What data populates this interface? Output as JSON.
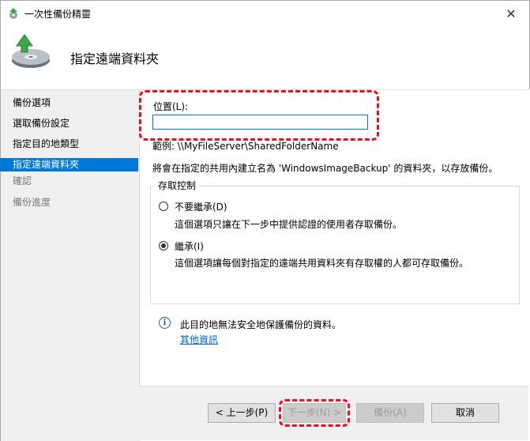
{
  "window": {
    "title": "一次性備份精靈",
    "close_glyph": "✕"
  },
  "header": {
    "title": "指定遠端資料夾"
  },
  "sidebar": {
    "items": [
      {
        "label": "備份選項",
        "state": "normal"
      },
      {
        "label": "選取備份設定",
        "state": "normal"
      },
      {
        "label": "指定目的地類型",
        "state": "normal"
      },
      {
        "label": "指定遠端資料夾",
        "state": "active"
      },
      {
        "label": "確認",
        "state": "disabled"
      },
      {
        "label": "備份進度",
        "state": "disabled"
      }
    ]
  },
  "main": {
    "location_label": "位置(L):",
    "location_value": "",
    "example": "範例: \\\\MyFileServer\\SharedFolderName",
    "description": "將會在指定的共用內建立名為 'WindowsImageBackup' 的資料夾，以存放備份。",
    "access_control": {
      "title": "存取控制",
      "options": [
        {
          "label": "不要繼承(D)",
          "description": "這個選項只讓在下一步中提供認證的使用者存取備份。",
          "selected": false
        },
        {
          "label": "繼承(I)",
          "description": "這個選項讓每個對指定的遠端共用資料夾有存取權的人都可存取備份。",
          "selected": true
        }
      ]
    },
    "warning": "此目的地無法安全地保護備份的資料。",
    "more_info_link": "其他資訊"
  },
  "buttons": {
    "back": "< 上一步(P)",
    "next": "下一步(N) >",
    "backup": "備份(A)",
    "cancel": "取消"
  },
  "colors": {
    "selection": "#0078d7",
    "highlight_box": "#e81123",
    "link": "#0066cc"
  }
}
